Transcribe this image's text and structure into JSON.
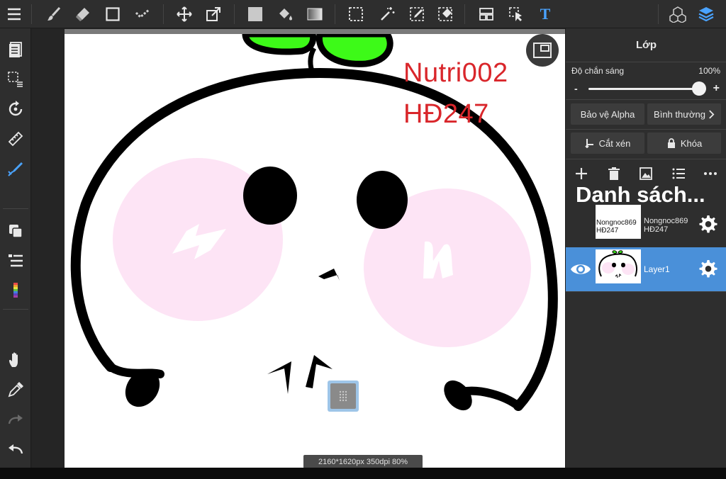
{
  "topbar": {
    "tools": [
      "menu-icon",
      "brush-icon",
      "eraser-icon",
      "rectangle-icon",
      "dot-brush-icon",
      "move-icon",
      "transform-icon",
      "fill-color-icon",
      "bucket-icon",
      "gradient-icon",
      "select-rect-icon",
      "magic-wand-icon",
      "select-pen-icon",
      "select-eraser-icon",
      "panel-layout-icon",
      "operation-icon",
      "text-icon",
      "material-icon",
      "layers-icon"
    ],
    "text_tool_glyph": "T"
  },
  "leftbar": {
    "tools": [
      "pages-icon",
      "selection-icon",
      "rotate-icon",
      "ruler-icon",
      "snap-pen-icon",
      "layer-copy-icon",
      "layer-list-icon",
      "color-palette-icon",
      "hand-icon",
      "eyedropper-icon",
      "redo-icon",
      "undo-icon"
    ]
  },
  "canvas": {
    "watermark_line1": "Nutri002",
    "watermark_line2": "HĐ247",
    "status": "2160*1620px 350dpi 80%"
  },
  "panel": {
    "title": "Lớp",
    "opacity_label": "Độ chắn sáng",
    "opacity_value": "100%",
    "opacity_percent": 100,
    "minus": "-",
    "plus": "+",
    "alpha_protect": "Bảo vệ Alpha",
    "blend_mode": "Bình thường",
    "clipping": "Cắt xén",
    "lock": "Khóa",
    "list_heading": "Danh sách...",
    "layers": [
      {
        "name": "Nongnoc869 HĐ247",
        "name_line1": "Nongnoc869",
        "name_line2": "HĐ247",
        "thumb_text_1": "Nongnoc869",
        "thumb_text_2": "HĐ247",
        "selected": false,
        "visible": false
      },
      {
        "name": "Layer1",
        "selected": true,
        "visible": true
      }
    ]
  },
  "colors": {
    "toolbar_bg": "#2e2e2e",
    "accent_blue": "#4a90d9",
    "selected_row": "#4a90d9",
    "watermark_red": "#d9262b",
    "leaf_green": "#3dfa18",
    "cheek_pink": "#fde4f5",
    "handle_blue": "#9ec5e8"
  }
}
